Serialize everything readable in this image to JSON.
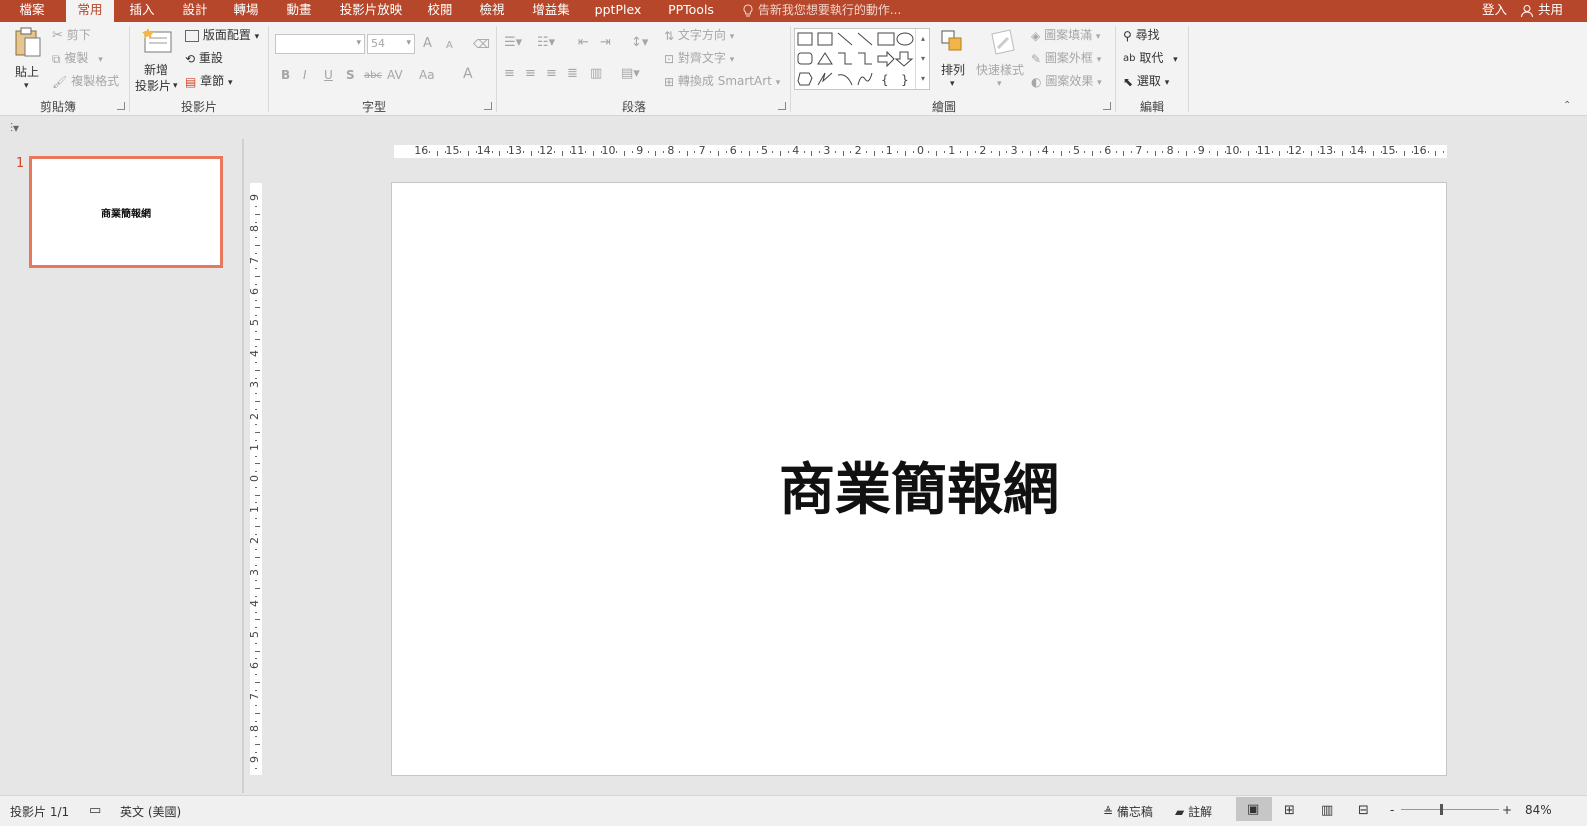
{
  "tabs": [
    {
      "label": "檔案",
      "active": false
    },
    {
      "label": "常用",
      "active": true
    },
    {
      "label": "插入",
      "active": false
    },
    {
      "label": "設計",
      "active": false
    },
    {
      "label": "轉場",
      "active": false
    },
    {
      "label": "動畫",
      "active": false
    },
    {
      "label": "投影片放映",
      "active": false
    },
    {
      "label": "校閱",
      "active": false
    },
    {
      "label": "檢視",
      "active": false
    },
    {
      "label": "增益集",
      "active": false
    },
    {
      "label": "pptPlex",
      "active": false
    },
    {
      "label": "PPTools",
      "active": false
    }
  ],
  "tell_me": "告新我您想要執行的動作...",
  "sign_in": "登入",
  "share": "共用",
  "clipboard": {
    "paste": "貼上",
    "cut": "剪下",
    "copy": "複製",
    "format_painter": "複製格式",
    "label": "剪貼簿"
  },
  "slides_group": {
    "new_slide_line1": "新增",
    "new_slide_line2": "投影片",
    "layout": "版面配置",
    "reset": "重設",
    "section": "章節",
    "label": "投影片"
  },
  "font_group": {
    "font_name": "",
    "font_size": "54",
    "bold": "B",
    "italic": "I",
    "underline": "U",
    "shadow": "S",
    "strike": "abc",
    "spacing": "AV",
    "case": "Aa",
    "color": "A",
    "grow": "A",
    "shrink": "A",
    "label": "字型"
  },
  "paragraph_group": {
    "text_direction": "文字方向",
    "align_text": "對齊文字",
    "smartart": "轉換成 SmartArt",
    "label": "段落"
  },
  "drawing_group": {
    "arrange": "排列",
    "quick_styles": "快速樣式",
    "shape_fill": "圖案填滿",
    "shape_outline": "圖案外框",
    "shape_effects": "圖案效果",
    "label": "繪圖"
  },
  "editing_group": {
    "find": "尋找",
    "replace": "取代",
    "select": "選取",
    "label": "編輯"
  },
  "thumbnail": {
    "number": "1",
    "text": "商業簡報網"
  },
  "slide": {
    "title": "商業簡報網"
  },
  "hruler_labels": [
    "16",
    "15",
    "14",
    "13",
    "12",
    "11",
    "10",
    "9",
    "8",
    "7",
    "6",
    "5",
    "4",
    "3",
    "2",
    "1",
    "0",
    "1",
    "2",
    "3",
    "4",
    "5",
    "6",
    "7",
    "8",
    "9",
    "10",
    "11",
    "12",
    "13",
    "14",
    "15",
    "16"
  ],
  "vruler_labels": [
    "9",
    "8",
    "7",
    "6",
    "5",
    "4",
    "3",
    "2",
    "1",
    "0",
    "1",
    "2",
    "3",
    "4",
    "5",
    "6",
    "7",
    "8",
    "9"
  ],
  "status": {
    "slide_count": "投影片 1/1",
    "language": "英文 (美國)",
    "notes": "備忘稿",
    "comments": "註解",
    "zoom_minus": "-",
    "zoom_plus": "+",
    "zoom": "84%"
  },
  "colors": {
    "accent": "#b7472a",
    "thumb_border": "#e8785c"
  }
}
